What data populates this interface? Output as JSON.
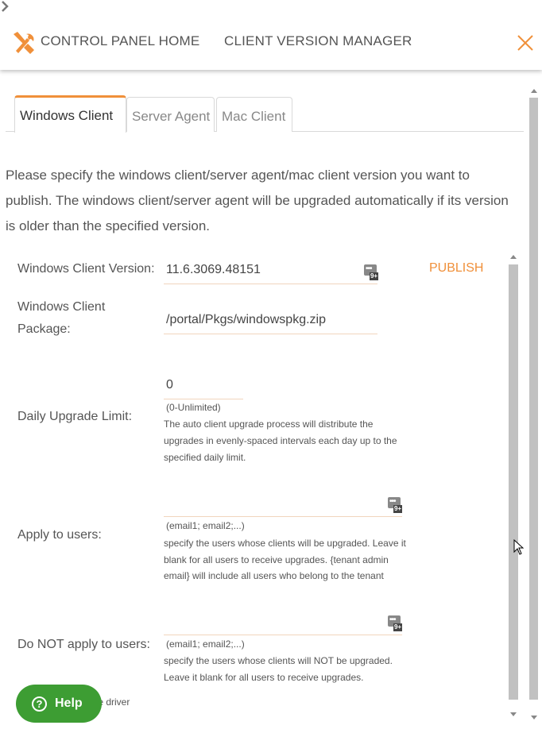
{
  "header": {
    "home_label": "CONTROL PANEL HOME",
    "current_label": "CLIENT VERSION MANAGER",
    "accent_color": "#f0903a"
  },
  "tabs": [
    {
      "label": "Windows Client",
      "active": true
    },
    {
      "label": "Server Agent",
      "active": false
    },
    {
      "label": "Mac Client",
      "active": false
    }
  ],
  "description": "Please specify the windows client/server agent/mac client version you want to publish. The windows client/server agent will be upgraded automatically if its version is older than the specified version.",
  "form": {
    "version": {
      "label": "Windows Client Version:",
      "value": "11.6.3069.48151",
      "publish_label": "PUBLISH"
    },
    "package": {
      "label_line1": "Windows Client",
      "label_line2": "Package:",
      "value": "/portal/Pkgs/windowspkg.zip"
    },
    "daily_limit": {
      "label": "Daily Upgrade Limit:",
      "value": "0",
      "hint": "(0-Unlimited)",
      "help_lines": [
        "The auto client upgrade process will distribute the",
        "upgrades in evenly-spaced intervals each day up to the",
        "specified daily limit."
      ]
    },
    "apply_users": {
      "label": "Apply to users:",
      "value": "",
      "hint": "(email1; email2;...)",
      "help_lines": [
        "specify the users whose clients will be upgraded. Leave it",
        "blank for all users to receive upgrades. {tenant admin",
        "email} will include all users who belong to the tenant"
      ]
    },
    "exclude_users": {
      "label": "Do NOT apply to users:",
      "value": "",
      "hint": "(email1; email2;...)",
      "help_lines": [
        "specify the users whose clients will NOT be upgraded.",
        "Leave it blank for all users to receive upgrades."
      ]
    },
    "partial_text": "ile driver"
  },
  "help_button": {
    "label": "Help",
    "color": "#3d9d33"
  },
  "icons": {
    "header": "tools-icon",
    "separator": "chevron-right-icon",
    "close": "close-icon",
    "picker": "user-picker-icon",
    "help": "question-circle-icon"
  }
}
